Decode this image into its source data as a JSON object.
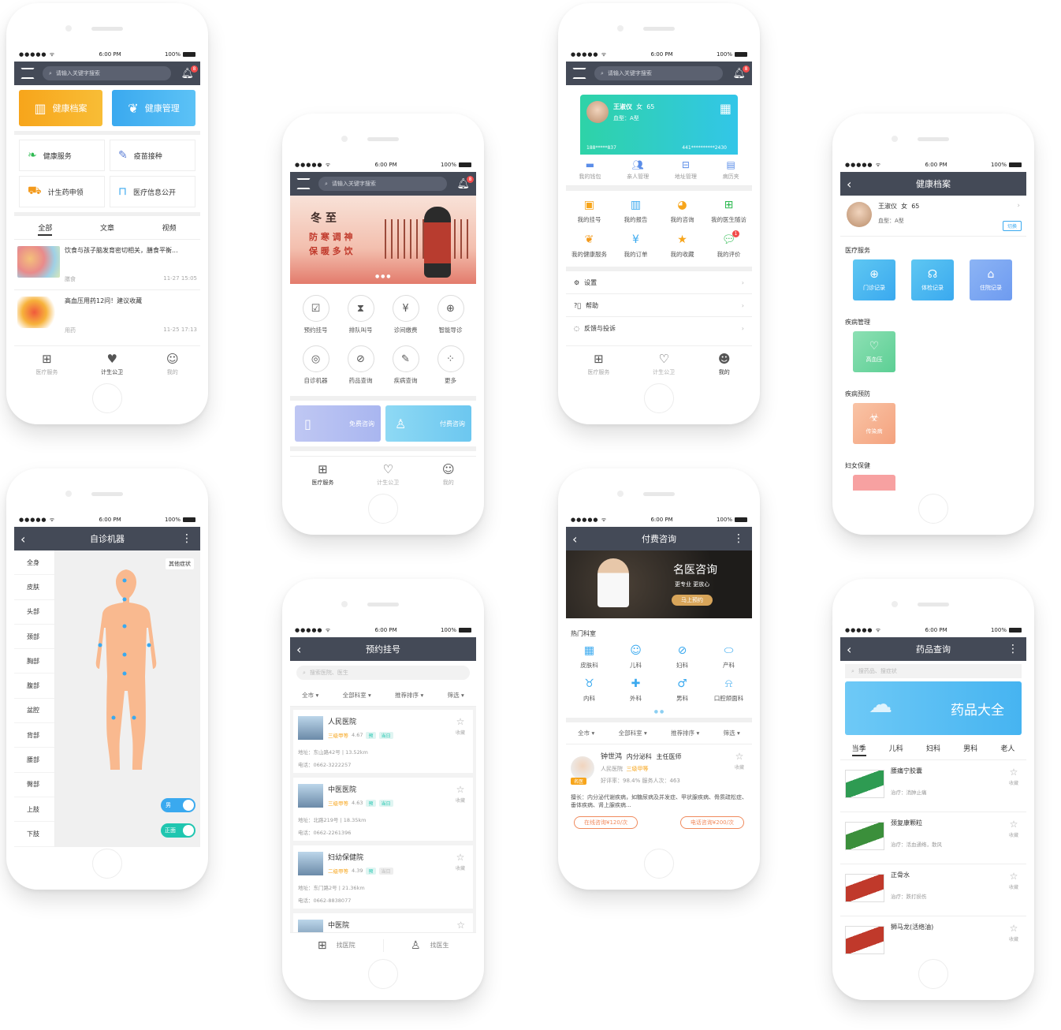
{
  "status": {
    "time": "6:00 PM",
    "battery": "100%",
    "signal": "●●●●● ᯤ"
  },
  "home": {
    "search_placeholder": "请输入关键字搜索",
    "notif_count": "8",
    "banner_left": "健康档案",
    "banner_right": "健康管理",
    "services": [
      "健康服务",
      "疫苗接种",
      "计生药申领",
      "医疗信息公开"
    ],
    "tabs": [
      "全部",
      "文章",
      "视频"
    ],
    "articles": [
      {
        "title": "饮食与孩子脑发育密切相关，膳食平衡...",
        "tag": "膳食",
        "date": "11-27  15:05"
      },
      {
        "title": "高血压用药12问！建议收藏",
        "tag": "用药",
        "date": "11-25  17:13"
      }
    ]
  },
  "tabbar": {
    "items": [
      "医疗服务",
      "计生公卫",
      "我的"
    ]
  },
  "hospital_home": {
    "search_placeholder": "请输入关键字搜索",
    "notif_count": "8",
    "banner_l1": "冬 至",
    "banner_l2": "防 寒 调 神",
    "banner_l3": "保 暖 多 饮",
    "grid": [
      "预约挂号",
      "排队叫号",
      "诊间缴费",
      "智能导诊",
      "自诊机器",
      "药品查询",
      "疾病查询",
      "更多"
    ],
    "consult_free": "免费咨询",
    "consult_paid": "付费咨询"
  },
  "profile": {
    "name": "王淑仪",
    "gender": "女",
    "age": "65",
    "blood": "血型：A型",
    "phone": "188*****837",
    "id_no": "441**********2430",
    "quick": [
      "我的钱包",
      "亲人管理",
      "地址管理",
      "病历夹"
    ],
    "menu": [
      "我的挂号",
      "我的报告",
      "我的咨询",
      "我的医生随访",
      "我的健康服务",
      "我的订单",
      "我的收藏",
      "我的评价"
    ],
    "review_badge": "1",
    "settings": [
      "设置",
      "帮助",
      "反馈与投诉"
    ]
  },
  "record": {
    "title": "健康档案",
    "name": "王淑仪",
    "gender": "女",
    "age": "65",
    "blood": "血型：A型",
    "switch_label": "切换",
    "section_medical": "医疗服务",
    "medical_items": [
      "门诊记录",
      "体检记录",
      "住院记录"
    ],
    "section_disease": "疾病管理",
    "disease_item": "高血压",
    "section_prevent": "疾病预防",
    "prevent_item": "传染病",
    "section_women": "妇女保健"
  },
  "selfdiag": {
    "title": "自诊机器",
    "parts": [
      "全身",
      "皮肤",
      "头部",
      "颈部",
      "胸部",
      "腹部",
      "盆腔",
      "背部",
      "腰部",
      "臀部",
      "上肢",
      "下肢"
    ],
    "other": "其他症状",
    "toggle_gender": "男",
    "toggle_view": "正面"
  },
  "appointment": {
    "title": "预约挂号",
    "search_placeholder": "搜索医院、医生",
    "filters": [
      "全市",
      "全部科室",
      "推荐排序",
      "筛选"
    ],
    "fav": "收藏",
    "tag_yu": "预",
    "tag_today": "当日",
    "hospitals": [
      {
        "name": "人民医院",
        "level": "三级甲等",
        "score": "4.67",
        "addr": "地址：东山路42号 | 13.52km",
        "tel": "电话：0662-3222257"
      },
      {
        "name": "中医医院",
        "level": "三级甲等",
        "score": "4.63",
        "addr": "地址：北路219号 | 18.35km",
        "tel": "电话：0662-2261396"
      },
      {
        "name": "妇幼保健院",
        "level": "二级甲等",
        "score": "4.39",
        "addr": "地址：东门路2号 | 21.36km",
        "tel": "电话：0662-8838077"
      },
      {
        "name": "中医院"
      }
    ],
    "bottom": [
      "找医院",
      "找医生"
    ]
  },
  "paid": {
    "title": "付费咨询",
    "banner_title": "名医咨询",
    "banner_sub": "更专业  更放心",
    "banner_btn": "马上预约",
    "dept_title": "热门科室",
    "depts": [
      "皮肤科",
      "儿科",
      "妇科",
      "产科",
      "内科",
      "外科",
      "男科",
      "口腔颌面科"
    ],
    "filters": [
      "全市",
      "全部科室",
      "推荐排序",
      "筛选"
    ],
    "doctor": {
      "name": "钟世鸿",
      "dept": "内分泌科",
      "title": "主任医师",
      "badge": "名医",
      "hospital": "人民医院",
      "level": "三级甲等",
      "stats": "好评率：98.4%   服务人次：463",
      "desc": "擅长：内分泌代谢疾病，如糖尿病及并发症、甲状腺疾病、骨质疏松症、垂体疾病、肾上腺疾病...",
      "btn_online": "在线咨询¥120/次",
      "btn_phone": "电话咨询¥200/次",
      "fav": "收藏"
    }
  },
  "drug": {
    "title": "药品查询",
    "search_placeholder": "搜药品、搜症状",
    "banner": "药品大全",
    "tabs": [
      "当季",
      "儿科",
      "妇科",
      "男科",
      "老人"
    ],
    "fav": "收藏",
    "items": [
      {
        "name": "腰痛宁胶囊",
        "desc": "治疗：消肿止痛"
      },
      {
        "name": "颈复康颗粒",
        "desc": "治疗：活血通络，散风"
      },
      {
        "name": "正骨水",
        "desc": "治疗：跌打损伤"
      },
      {
        "name": "狮马龙(活络油)",
        "desc": ""
      }
    ]
  },
  "colors": {
    "nav": "#444a57",
    "orange": "#f7a51b",
    "blue": "#3aa9ef",
    "teal": "#20c6b0",
    "red": "#f24a4a"
  }
}
